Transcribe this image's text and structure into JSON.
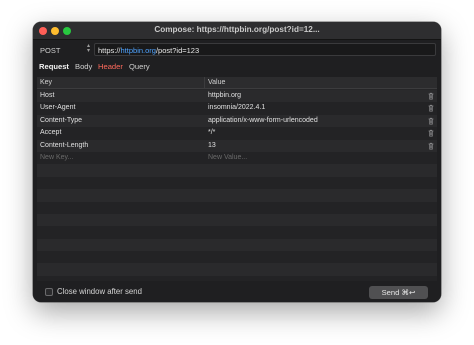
{
  "window": {
    "title": "Compose: https://httpbin.org/post?id=12..."
  },
  "request": {
    "method": "POST",
    "url": {
      "scheme": "https://",
      "host": "httpbin.org",
      "path": "/post",
      "query": "?id=123"
    }
  },
  "tabs": [
    {
      "label": "Request"
    },
    {
      "label": "Body"
    },
    {
      "label": "Header"
    },
    {
      "label": "Query"
    }
  ],
  "table": {
    "columns": {
      "key": "Key",
      "value": "Value"
    },
    "rows": [
      {
        "key": "Host",
        "value": "httpbin.org"
      },
      {
        "key": "User-Agent",
        "value": "insomnia/2022.4.1"
      },
      {
        "key": "Content-Type",
        "value": "application/x-www-form-urlencoded"
      },
      {
        "key": "Accept",
        "value": "*/*"
      },
      {
        "key": "Content-Length",
        "value": "13"
      }
    ],
    "new_key_placeholder": "New Key...",
    "new_value_placeholder": "New Value..."
  },
  "footer": {
    "close_after_send_label": "Close window after send",
    "send_label": "Send ⌘↩"
  },
  "colors": {
    "accent_tab": "#ff6a5c",
    "url_host": "#4fa3ff",
    "close": "#ff5f57",
    "minimize": "#febc2e",
    "maximize": "#28c840"
  }
}
